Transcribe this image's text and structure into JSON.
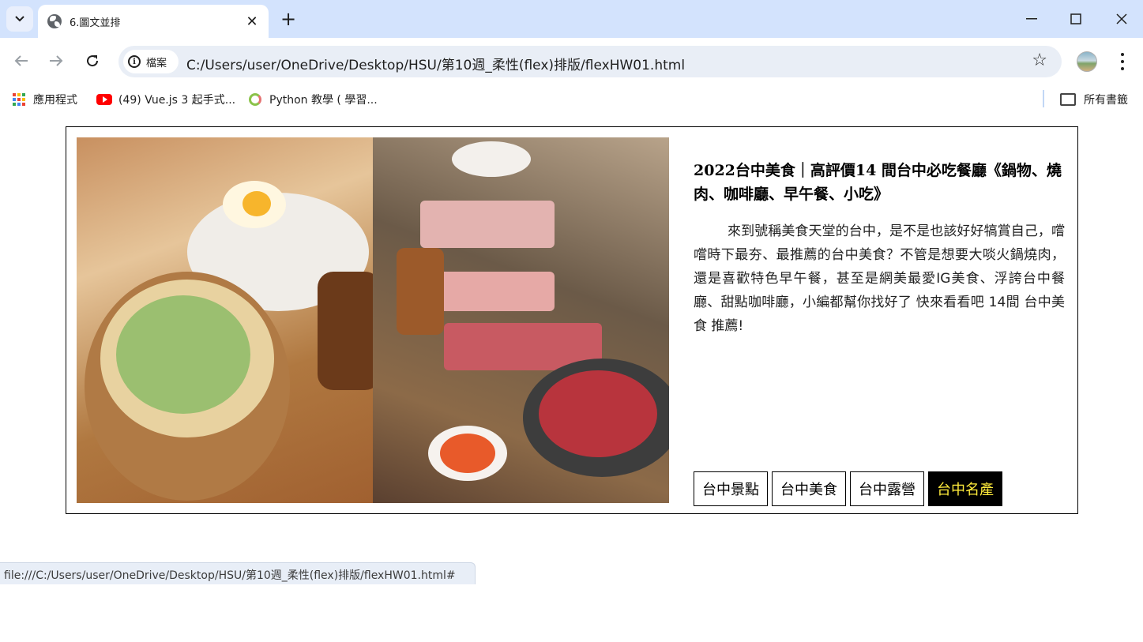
{
  "browser": {
    "tab": {
      "title": "6.圖文並排"
    },
    "address": {
      "security_label": "檔案",
      "url": "C:/Users/user/OneDrive/Desktop/HSU/第10週_柔性(flex)排版/flexHW01.html"
    },
    "bookmarks": [
      {
        "label": "應用程式",
        "icon": "apps-grid-icon"
      },
      {
        "label": "(49) Vue.js 3 起手式...",
        "icon": "youtube-icon"
      },
      {
        "label": "Python 教學 ( 學習...",
        "icon": "python-icon"
      }
    ],
    "all_bookmarks_label": "所有書籤",
    "status_url": "file:///C:/Users/user/OneDrive/Desktop/HSU/第10週_柔性(flex)排版/flexHW01.html#"
  },
  "article": {
    "title": "2022台中美食｜高評價14 間台中必吃餐廳《鍋物、燒肉、咖啡廳、早午餐、小吃》",
    "body": "來到號稱美食天堂的台中，是不是也該好好犒賞自己，嚐嚐時下最夯、最推薦的台中美食？不管是想要大啖火鍋燒肉，還是喜歡特色早午餐，甚至是網美最愛IG美食、浮誇台中餐廳、甜點咖啡廳，小編都幫你找好了 快來看看吧 14間 台中美食 推薦!",
    "tags": [
      {
        "label": "台中景點",
        "active": false
      },
      {
        "label": "台中美食",
        "active": false
      },
      {
        "label": "台中露營",
        "active": false
      },
      {
        "label": "台中名產",
        "active": true
      }
    ]
  },
  "colors": {
    "tab_strip": "#d3e3fd",
    "active_tag_bg": "#000000",
    "active_tag_text": "#ffeb3b"
  }
}
